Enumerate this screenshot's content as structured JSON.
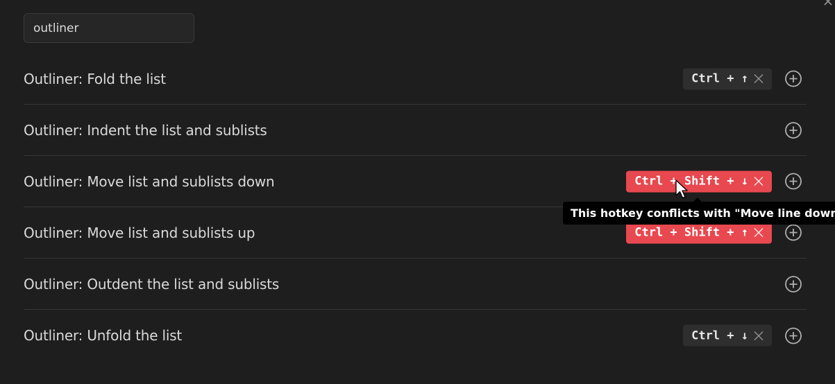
{
  "search": {
    "value": "outliner"
  },
  "commands": [
    {
      "label": "Outliner: Fold the list",
      "hotkey": "Ctrl + ↑",
      "conflict": false
    },
    {
      "label": "Outliner: Indent the list and sublists",
      "hotkey": null,
      "conflict": false
    },
    {
      "label": "Outliner: Move list and sublists down",
      "hotkey": "Ctrl + Shift + ↓",
      "conflict": true
    },
    {
      "label": "Outliner: Move list and sublists up",
      "hotkey": "Ctrl + Shift + ↑",
      "conflict": true
    },
    {
      "label": "Outliner: Outdent the list and sublists",
      "hotkey": null,
      "conflict": false
    },
    {
      "label": "Outliner: Unfold the list",
      "hotkey": "Ctrl + ↓",
      "conflict": false
    }
  ],
  "tooltip": {
    "text": "This hotkey conflicts with \"Move line down\""
  },
  "colors": {
    "background": "#1e1e1e",
    "conflict": "#e8484f",
    "hotkey_bg": "#2e2e2e"
  },
  "icons": {
    "close": "close-icon",
    "remove_hotkey": "x-icon",
    "add_hotkey": "plus-circle-icon",
    "cursor": "mouse-pointer-icon"
  }
}
